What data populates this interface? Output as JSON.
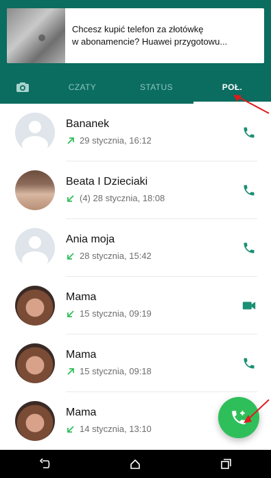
{
  "ad": {
    "line1": "Chcesz kupić telefon za złotówkę",
    "line2": "w abonamencie? Huawei przygotowu..."
  },
  "tabs": [
    {
      "label": "CZATY"
    },
    {
      "label": "STATUS"
    },
    {
      "label": "POŁ."
    }
  ],
  "calls": [
    {
      "name": "Bananek",
      "detail": "29 stycznia, 16:12",
      "direction": "outgoing",
      "type": "voice",
      "avatar": "default"
    },
    {
      "name": "Beata I Dzieciaki",
      "detail": "(4)  28 stycznia, 18:08",
      "direction": "incoming",
      "type": "voice",
      "avatar": "photo"
    },
    {
      "name": "Ania moja",
      "detail": "28 stycznia, 15:42",
      "direction": "incoming",
      "type": "voice",
      "avatar": "default"
    },
    {
      "name": "Mama",
      "detail": "15 stycznia, 09:19",
      "direction": "incoming",
      "type": "video",
      "avatar": "photo"
    },
    {
      "name": "Mama",
      "detail": "15 stycznia, 09:18",
      "direction": "outgoing",
      "type": "voice",
      "avatar": "photo"
    },
    {
      "name": "Mama",
      "detail": "14 stycznia, 13:10",
      "direction": "incoming",
      "type": "voice",
      "avatar": "photo"
    }
  ],
  "colors": {
    "header": "#0b6c60",
    "accent": "#2fbf5a",
    "call_icon": "#1b8f73",
    "annotation": "#e01b1b"
  }
}
